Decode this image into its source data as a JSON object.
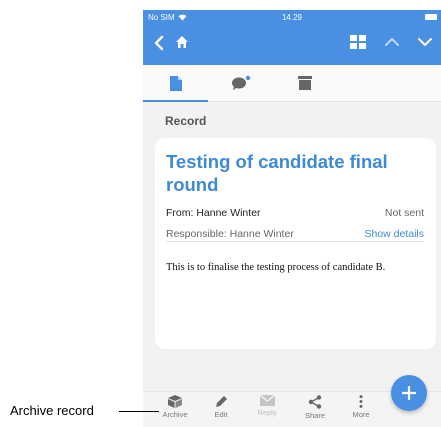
{
  "status_bar": {
    "carrier": "No SIM",
    "time": "14.29"
  },
  "section_label": "Record",
  "record": {
    "title": "Testing of candidate final round",
    "from": "From: Hanne Winter",
    "status": "Not sent",
    "responsible": "Responsible: Hanne Winter",
    "show_details": "Show details",
    "body": "This is to finalise the testing process of candidate B."
  },
  "toolbar": {
    "items": [
      {
        "label": "Archive",
        "icon": "archive-icon",
        "enabled": true
      },
      {
        "label": "Edit",
        "icon": "pencil-icon",
        "enabled": true
      },
      {
        "label": "Reply",
        "icon": "envelope-icon",
        "enabled": false
      },
      {
        "label": "Share",
        "icon": "share-icon",
        "enabled": true
      },
      {
        "label": "More",
        "icon": "more-vertical-icon",
        "enabled": true
      }
    ]
  },
  "annotation": {
    "label": "Archive record"
  },
  "colors": {
    "accent": "#4a90e2",
    "title": "#3e8ad7",
    "link": "#3e8ad7",
    "notification_dot": "#4a90e2"
  }
}
